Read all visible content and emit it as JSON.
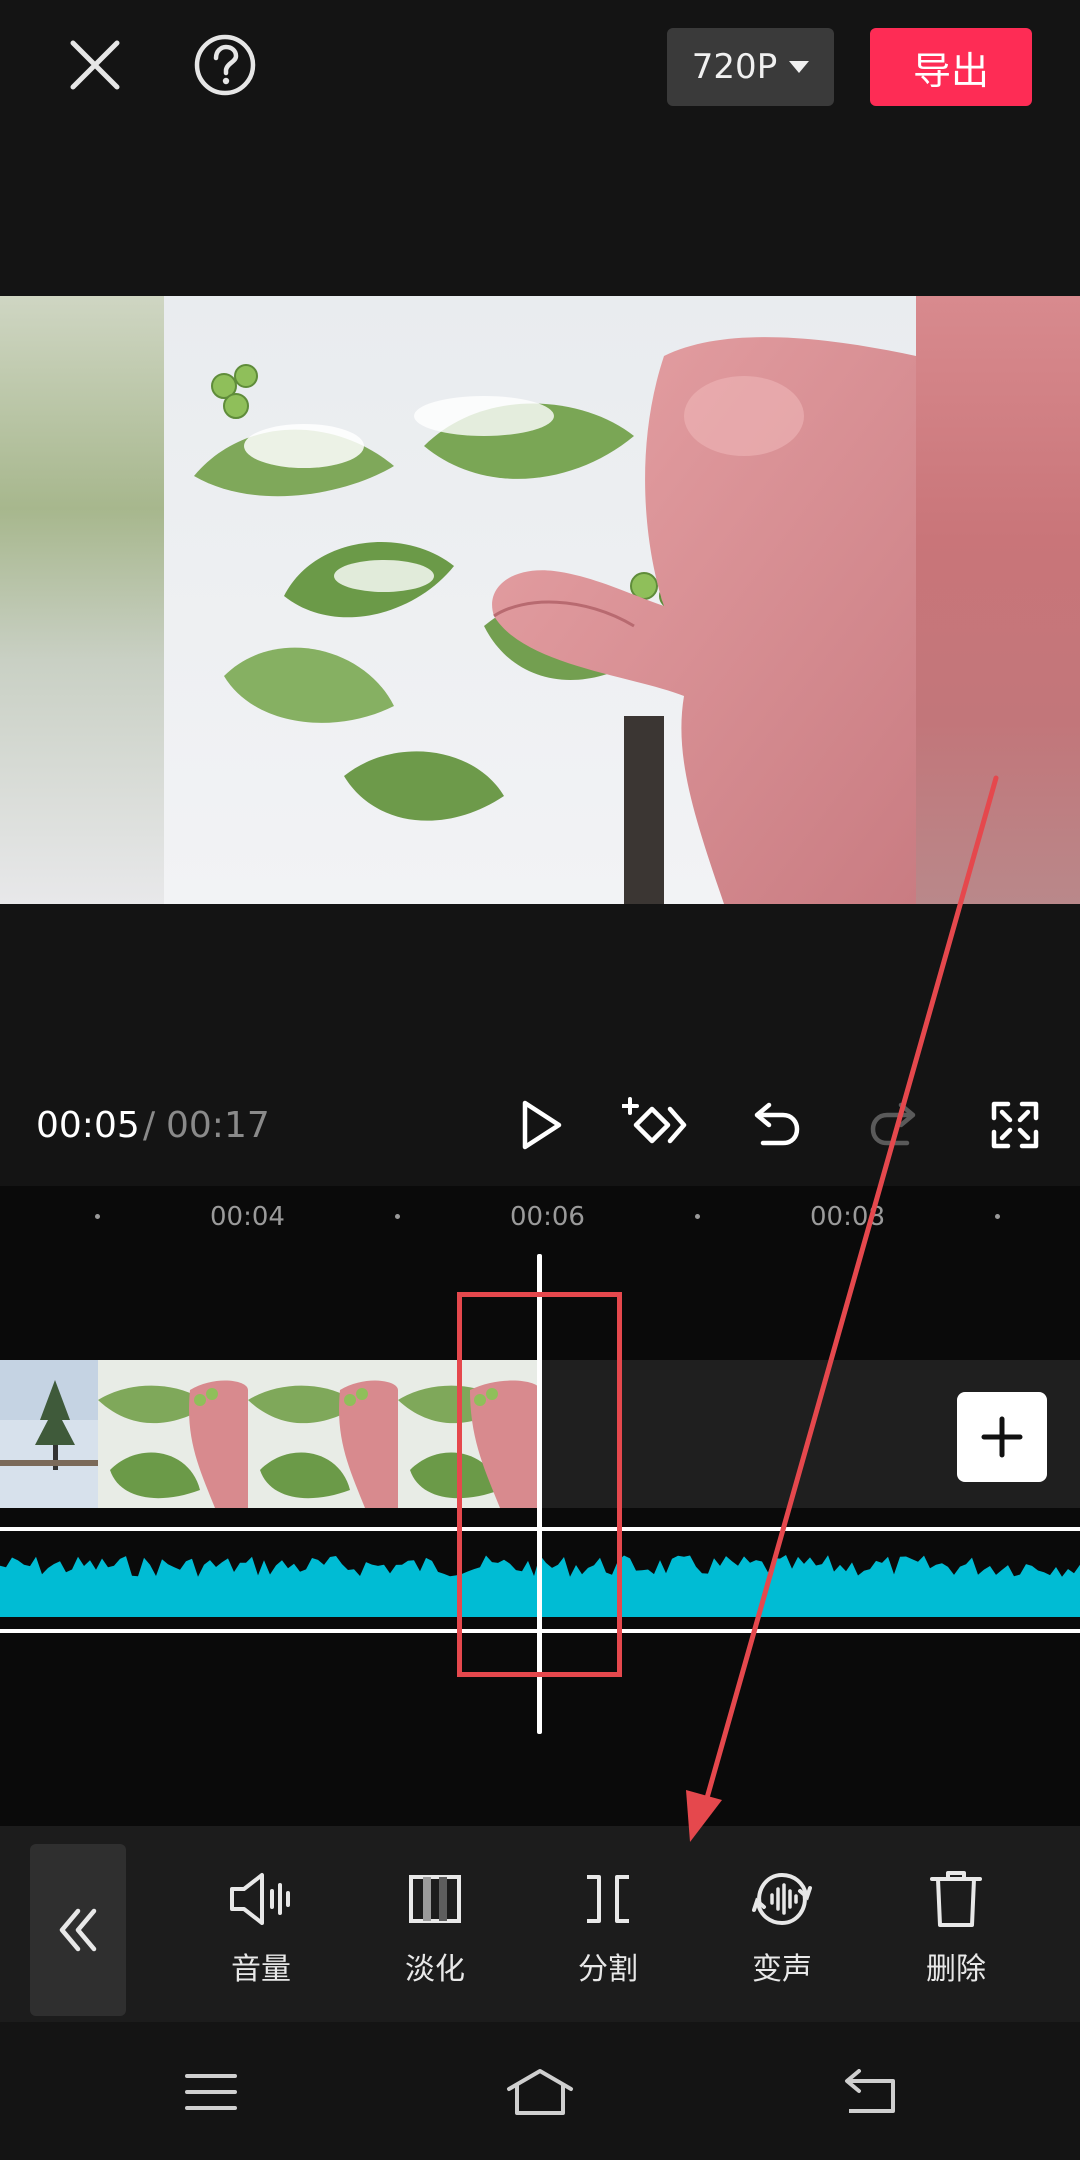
{
  "top_bar": {
    "resolution_label": "720P",
    "export_label": "导出"
  },
  "playback": {
    "current_time": "00:05",
    "separator": "/",
    "total_time": "00:17"
  },
  "timeline": {
    "ruler_labels": [
      "00:04",
      "00:06",
      "00:08"
    ]
  },
  "tools": [
    {
      "label": "音量",
      "icon": "volume-icon"
    },
    {
      "label": "淡化",
      "icon": "fade-icon"
    },
    {
      "label": "分割",
      "icon": "split-icon"
    },
    {
      "label": "变声",
      "icon": "voice-change-icon"
    },
    {
      "label": "删除",
      "icon": "delete-icon"
    }
  ],
  "colors": {
    "export_accent": "#fe2c55",
    "waveform": "#00bcd4",
    "annotation": "#e5484d"
  }
}
